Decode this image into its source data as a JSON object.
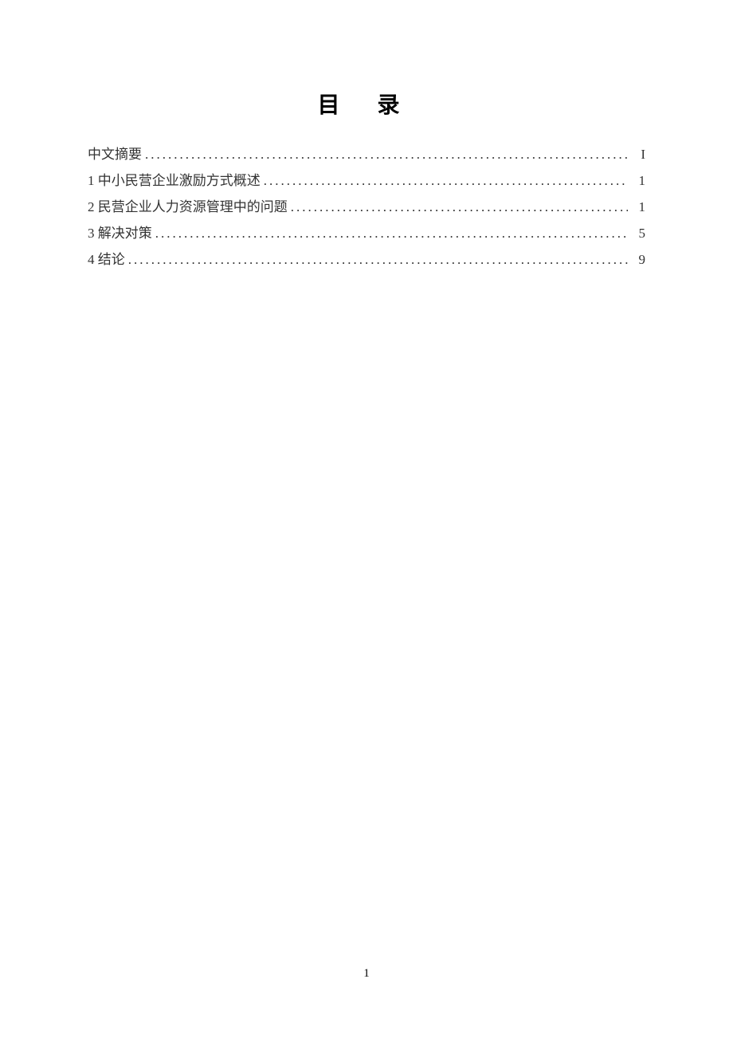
{
  "title": "目 录",
  "toc": {
    "entries": [
      {
        "label": "中文摘要",
        "page": "I"
      },
      {
        "label": "1  中小民营企业激励方式概述",
        "page": "1"
      },
      {
        "label": "2 民营企业人力资源管理中的问题",
        "page": "1"
      },
      {
        "label": "3  解决对策 ",
        "page": "5"
      },
      {
        "label": "4  结论 ",
        "page": "9"
      }
    ]
  },
  "page_number": "1"
}
